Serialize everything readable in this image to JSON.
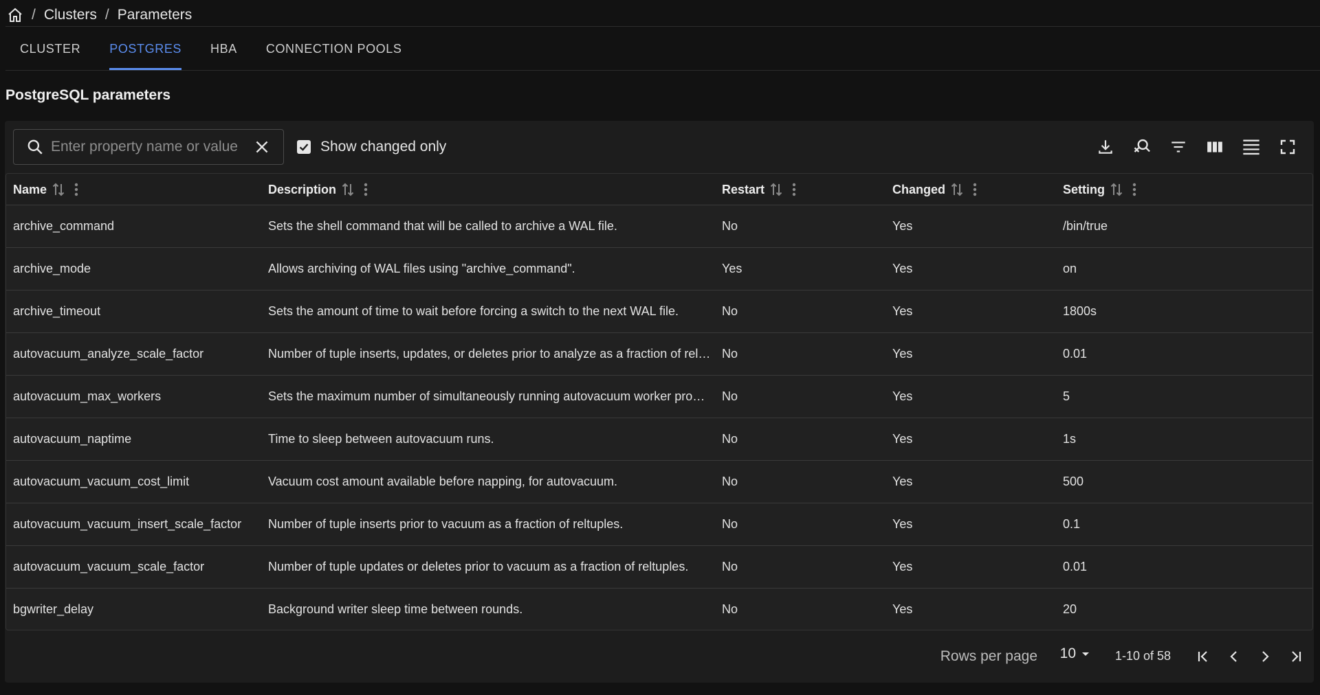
{
  "breadcrumb": {
    "home_icon": "home-icon",
    "items": [
      "Clusters",
      "Parameters"
    ],
    "separator": "/"
  },
  "tabs": [
    {
      "label": "CLUSTER",
      "active": false
    },
    {
      "label": "POSTGRES",
      "active": true
    },
    {
      "label": "HBA",
      "active": false
    },
    {
      "label": "CONNECTION POOLS",
      "active": false
    }
  ],
  "section_title": "PostgreSQL parameters",
  "toolbar": {
    "search_placeholder": "Enter property name or value",
    "search_value": "",
    "show_changed_label": "Show changed only",
    "show_changed_checked": true,
    "tools": [
      "download-icon",
      "clear-search-icon",
      "filter-icon",
      "columns-icon",
      "density-icon",
      "fullscreen-icon"
    ]
  },
  "table": {
    "columns": [
      "Name",
      "Description",
      "Restart",
      "Changed",
      "Setting"
    ],
    "rows": [
      [
        "archive_command",
        "Sets the shell command that will be called to archive a WAL file.",
        "No",
        "Yes",
        "/bin/true"
      ],
      [
        "archive_mode",
        "Allows archiving of WAL files using \"archive_command\".",
        "Yes",
        "Yes",
        "on"
      ],
      [
        "archive_timeout",
        "Sets the amount of time to wait before forcing a switch to the next WAL file.",
        "No",
        "Yes",
        "1800s"
      ],
      [
        "autovacuum_analyze_scale_factor",
        "Number of tuple inserts, updates, or deletes prior to analyze as a fraction of reltuples.",
        "No",
        "Yes",
        "0.01"
      ],
      [
        "autovacuum_max_workers",
        "Sets the maximum number of simultaneously running autovacuum worker processes.",
        "No",
        "Yes",
        "5"
      ],
      [
        "autovacuum_naptime",
        "Time to sleep between autovacuum runs.",
        "No",
        "Yes",
        "1s"
      ],
      [
        "autovacuum_vacuum_cost_limit",
        "Vacuum cost amount available before napping, for autovacuum.",
        "No",
        "Yes",
        "500"
      ],
      [
        "autovacuum_vacuum_insert_scale_factor",
        "Number of tuple inserts prior to vacuum as a fraction of reltuples.",
        "No",
        "Yes",
        "0.1"
      ],
      [
        "autovacuum_vacuum_scale_factor",
        "Number of tuple updates or deletes prior to vacuum as a fraction of reltuples.",
        "No",
        "Yes",
        "0.01"
      ],
      [
        "bgwriter_delay",
        "Background writer sleep time between rounds.",
        "No",
        "Yes",
        "20"
      ]
    ]
  },
  "pagination": {
    "rows_per_page_label": "Rows per page",
    "rows_per_page_value": "10",
    "range_text": "1-10 of 58"
  },
  "colors": {
    "accent": "#5b8def",
    "background": "#121212",
    "panel": "#1d1d1d"
  }
}
